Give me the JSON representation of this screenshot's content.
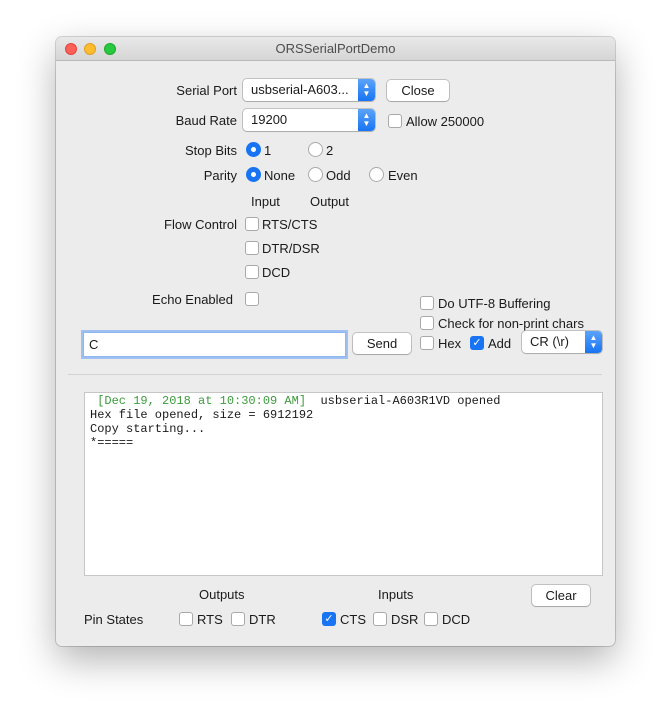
{
  "window": {
    "title": "ORSSerialPortDemo"
  },
  "serial": {
    "port_label": "Serial Port",
    "port_value": "usbserial-A603...",
    "open_close_label": "Close",
    "baud_label": "Baud Rate",
    "baud_value": "19200",
    "allow_label": "Allow 250000",
    "allow_checked": false
  },
  "stop_bits": {
    "label": "Stop Bits",
    "options": [
      "1",
      "2"
    ],
    "selected": "1"
  },
  "parity": {
    "label": "Parity",
    "options": [
      "None",
      "Odd",
      "Even"
    ],
    "selected": "None"
  },
  "flow": {
    "input_header": "Input",
    "output_header": "Output",
    "label": "Flow Control",
    "options": [
      "RTS/CTS",
      "DTR/DSR",
      "DCD"
    ]
  },
  "echo": {
    "label": "Echo Enabled",
    "checked": false
  },
  "options": {
    "utf8_label": "Do UTF-8 Buffering",
    "nonprint_label": "Check for non-print chars",
    "hex_label": "Hex",
    "hex_checked": false,
    "add_label": "Add",
    "add_checked": true,
    "line_ending": "CR (\\r)"
  },
  "send": {
    "input_value": "C",
    "button_label": "Send"
  },
  "console": {
    "lines": [
      {
        "timestamp": "[Dec 19, 2018 at 10:30:09 AM]",
        "text": "  usbserial-A603R1VD opened"
      },
      {
        "timestamp": "",
        "text": "Hex file opened, size = 6912192"
      },
      {
        "timestamp": "",
        "text": "Copy starting..."
      },
      {
        "timestamp": "",
        "text": "*====="
      }
    ]
  },
  "pins": {
    "outputs_header": "Outputs",
    "inputs_header": "Inputs",
    "clear_label": "Clear",
    "label": "Pin States",
    "rts_label": "RTS",
    "rts_checked": false,
    "dtr_label": "DTR",
    "dtr_checked": false,
    "cts_label": "CTS",
    "cts_checked": true,
    "dsr_label": "DSR",
    "dsr_checked": false,
    "dcd_label": "DCD",
    "dcd_checked": false
  },
  "colors": {
    "accent": "#1874f2",
    "timestamp": "#3c9a3c"
  }
}
